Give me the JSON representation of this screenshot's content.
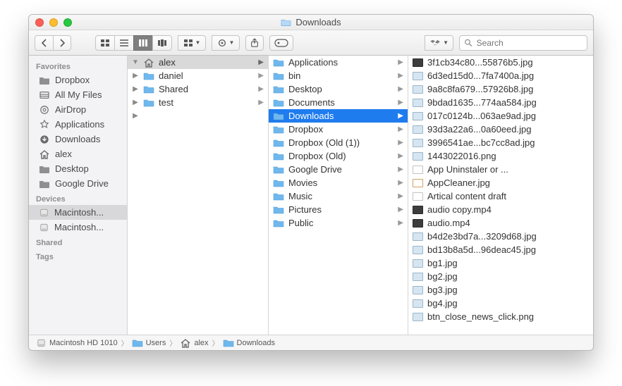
{
  "title": "Downloads",
  "search_placeholder": "Search",
  "sidebar": {
    "favorites_label": "Favorites",
    "devices_label": "Devices",
    "shared_label": "Shared",
    "tags_label": "Tags",
    "favorites": [
      {
        "label": "Dropbox",
        "icon": "folder-gray"
      },
      {
        "label": "All My Files",
        "icon": "allmyfiles"
      },
      {
        "label": "AirDrop",
        "icon": "airdrop"
      },
      {
        "label": "Applications",
        "icon": "applications"
      },
      {
        "label": "Downloads",
        "icon": "downloads"
      },
      {
        "label": "alex",
        "icon": "house"
      },
      {
        "label": "Desktop",
        "icon": "folder-gray"
      },
      {
        "label": "Google Drive",
        "icon": "folder-gray"
      }
    ],
    "devices": [
      {
        "label": "Macintosh...",
        "icon": "disk",
        "selected": true
      },
      {
        "label": "Macintosh...",
        "icon": "disk"
      }
    ]
  },
  "columns": [
    {
      "items": [
        {
          "name": "alex",
          "icon": "house",
          "hasChildren": true,
          "exp": true,
          "highlight": true
        },
        {
          "name": "daniel",
          "icon": "folder",
          "hasChildren": true
        },
        {
          "name": "Shared",
          "icon": "folder",
          "hasChildren": true
        },
        {
          "name": "test",
          "icon": "folder",
          "hasChildren": true
        }
      ]
    },
    {
      "items": [
        {
          "name": "Applications",
          "icon": "folder",
          "hasChildren": true
        },
        {
          "name": "bin",
          "icon": "folder",
          "hasChildren": true
        },
        {
          "name": "Desktop",
          "icon": "folder",
          "hasChildren": true
        },
        {
          "name": "Documents",
          "icon": "folder",
          "hasChildren": true
        },
        {
          "name": "Downloads",
          "icon": "folder",
          "hasChildren": true,
          "selected": true
        },
        {
          "name": "Dropbox",
          "icon": "folder",
          "hasChildren": true
        },
        {
          "name": "Dropbox (Old (1))",
          "icon": "folder",
          "hasChildren": true
        },
        {
          "name": "Dropbox (Old)",
          "icon": "folder",
          "hasChildren": true
        },
        {
          "name": "Google Drive",
          "icon": "folder",
          "hasChildren": true
        },
        {
          "name": "Movies",
          "icon": "folder",
          "hasChildren": true
        },
        {
          "name": "Music",
          "icon": "folder",
          "hasChildren": true
        },
        {
          "name": "Pictures",
          "icon": "folder",
          "hasChildren": true
        },
        {
          "name": "Public",
          "icon": "folder",
          "hasChildren": true
        }
      ]
    },
    {
      "items": [
        {
          "name": "3f1cb34c80...55876b5.jpg",
          "icon": "img-dark"
        },
        {
          "name": "6d3ed15d0...7fa7400a.jpg",
          "icon": "img"
        },
        {
          "name": "9a8c8fa679...57926b8.jpg",
          "icon": "img"
        },
        {
          "name": "9bdad1635...774aa584.jpg",
          "icon": "img"
        },
        {
          "name": "017c0124b...063ae9ad.jpg",
          "icon": "img"
        },
        {
          "name": "93d3a22a6...0a60eed.jpg",
          "icon": "img"
        },
        {
          "name": "3996541ae...bc7cc8ad.jpg",
          "icon": "img"
        },
        {
          "name": "1443022016.png",
          "icon": "img"
        },
        {
          "name": "App Uninstaler or ...",
          "icon": "doc"
        },
        {
          "name": "AppCleaner.jpg",
          "icon": "app"
        },
        {
          "name": "Artical content draft",
          "icon": "doc"
        },
        {
          "name": "audio copy.mp4",
          "icon": "media"
        },
        {
          "name": "audio.mp4",
          "icon": "media"
        },
        {
          "name": "b4d2e3bd7a...3209d68.jpg",
          "icon": "img"
        },
        {
          "name": "bd13b8a5d...96deac45.jpg",
          "icon": "img"
        },
        {
          "name": "bg1.jpg",
          "icon": "img"
        },
        {
          "name": "bg2.jpg",
          "icon": "img"
        },
        {
          "name": "bg3.jpg",
          "icon": "img"
        },
        {
          "name": "bg4.jpg",
          "icon": "img"
        },
        {
          "name": "btn_close_news_click.png",
          "icon": "img"
        }
      ]
    }
  ],
  "pathbar": [
    {
      "label": "Macintosh HD 1010",
      "icon": "disk"
    },
    {
      "label": "Users",
      "icon": "folder"
    },
    {
      "label": "alex",
      "icon": "house"
    },
    {
      "label": "Downloads",
      "icon": "folder"
    }
  ]
}
